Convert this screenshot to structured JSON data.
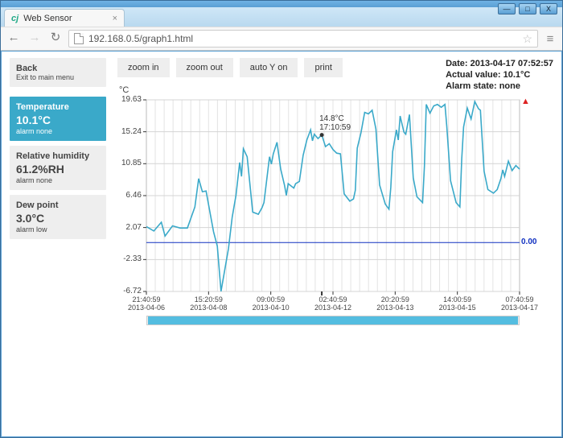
{
  "browser": {
    "tab_title": "Web Sensor",
    "url": "192.168.0.5/graph1.html",
    "wc_min": "—",
    "wc_max": "□",
    "wc_close": "X",
    "tab_close": "×",
    "star": "☆",
    "menu": "≡",
    "nav_back": "←",
    "nav_fwd": "→",
    "nav_reload": "↻"
  },
  "sidebar": {
    "back": {
      "title": "Back",
      "sub": "Exit to main menu"
    },
    "cards": [
      {
        "title": "Temperature",
        "value": "10.1°C",
        "alarm": "alarm none",
        "active": true
      },
      {
        "title": "Relative humidity",
        "value": "61.2%RH",
        "alarm": "alarm none",
        "active": false
      },
      {
        "title": "Dew point",
        "value": "3.0°C",
        "alarm": "alarm low",
        "active": false
      }
    ]
  },
  "toolbar": {
    "zoom_in": "zoom in",
    "zoom_out": "zoom out",
    "auto_y": "auto Y on",
    "print": "print"
  },
  "info": {
    "date": "Date: 2013-04-17 07:52:57",
    "actual": "Actual value: 10.1°C",
    "alarm": "Alarm state: none"
  },
  "chart_data": {
    "type": "line",
    "unit": "°C",
    "ylim": [
      -6.72,
      19.63
    ],
    "yticks": [
      19.63,
      15.24,
      10.85,
      6.46,
      2.07,
      -2.33,
      -6.72
    ],
    "zero_line": 0.0,
    "zero_label": "0.00",
    "xticks": [
      {
        "time": "21:40:59",
        "date": "2013-04-06"
      },
      {
        "time": "15:20:59",
        "date": "2013-04-08"
      },
      {
        "time": "09:00:59",
        "date": "2013-04-10"
      },
      {
        "time": "02:40:59",
        "date": "2013-04-12"
      },
      {
        "time": "20:20:59",
        "date": "2013-04-13"
      },
      {
        "time": "14:00:59",
        "date": "2013-04-15"
      },
      {
        "time": "07:40:59",
        "date": "2013-04-17"
      }
    ],
    "marker": {
      "value": "14.8°C",
      "time": "17:10:59",
      "x_frac": 0.47,
      "y_val": 14.8
    },
    "series": [
      {
        "name": "Temperature",
        "points": [
          [
            0.0,
            2.2
          ],
          [
            0.02,
            1.6
          ],
          [
            0.04,
            2.8
          ],
          [
            0.05,
            0.9
          ],
          [
            0.07,
            2.3
          ],
          [
            0.09,
            2.0
          ],
          [
            0.11,
            2.0
          ],
          [
            0.13,
            4.9
          ],
          [
            0.14,
            8.8
          ],
          [
            0.15,
            7.0
          ],
          [
            0.16,
            7.1
          ],
          [
            0.18,
            1.5
          ],
          [
            0.19,
            -0.5
          ],
          [
            0.2,
            -6.7
          ],
          [
            0.22,
            -0.8
          ],
          [
            0.23,
            3.5
          ],
          [
            0.24,
            6.5
          ],
          [
            0.25,
            11.0
          ],
          [
            0.255,
            9.1
          ],
          [
            0.26,
            12.9
          ],
          [
            0.27,
            11.8
          ],
          [
            0.285,
            4.2
          ],
          [
            0.3,
            3.9
          ],
          [
            0.31,
            4.8
          ],
          [
            0.315,
            5.5
          ],
          [
            0.33,
            11.8
          ],
          [
            0.335,
            10.8
          ],
          [
            0.34,
            12.2
          ],
          [
            0.35,
            13.8
          ],
          [
            0.36,
            10.1
          ],
          [
            0.37,
            7.9
          ],
          [
            0.375,
            6.5
          ],
          [
            0.38,
            8.1
          ],
          [
            0.395,
            7.5
          ],
          [
            0.4,
            8.1
          ],
          [
            0.41,
            8.4
          ],
          [
            0.42,
            12.0
          ],
          [
            0.43,
            14.1
          ],
          [
            0.44,
            15.5
          ],
          [
            0.445,
            14.0
          ],
          [
            0.45,
            14.9
          ],
          [
            0.46,
            14.3
          ],
          [
            0.47,
            14.8
          ],
          [
            0.48,
            13.2
          ],
          [
            0.49,
            13.6
          ],
          [
            0.5,
            12.8
          ],
          [
            0.51,
            12.3
          ],
          [
            0.52,
            12.2
          ],
          [
            0.53,
            6.7
          ],
          [
            0.545,
            5.7
          ],
          [
            0.555,
            6.0
          ],
          [
            0.56,
            7.2
          ],
          [
            0.565,
            13.0
          ],
          [
            0.575,
            15.1
          ],
          [
            0.585,
            17.9
          ],
          [
            0.595,
            17.7
          ],
          [
            0.605,
            18.2
          ],
          [
            0.615,
            15.6
          ],
          [
            0.625,
            7.9
          ],
          [
            0.64,
            5.3
          ],
          [
            0.65,
            4.6
          ],
          [
            0.655,
            7.6
          ],
          [
            0.66,
            12.5
          ],
          [
            0.67,
            15.5
          ],
          [
            0.675,
            14.1
          ],
          [
            0.68,
            17.4
          ],
          [
            0.69,
            15.2
          ],
          [
            0.695,
            14.9
          ],
          [
            0.705,
            17.6
          ],
          [
            0.715,
            8.9
          ],
          [
            0.725,
            6.3
          ],
          [
            0.74,
            5.5
          ],
          [
            0.745,
            10.5
          ],
          [
            0.75,
            19.0
          ],
          [
            0.76,
            17.8
          ],
          [
            0.77,
            18.8
          ],
          [
            0.78,
            19.0
          ],
          [
            0.79,
            18.6
          ],
          [
            0.8,
            19.0
          ],
          [
            0.805,
            16.0
          ],
          [
            0.815,
            8.5
          ],
          [
            0.83,
            5.5
          ],
          [
            0.84,
            4.9
          ],
          [
            0.845,
            11.5
          ],
          [
            0.85,
            15.9
          ],
          [
            0.855,
            17.2
          ],
          [
            0.86,
            18.5
          ],
          [
            0.87,
            17.0
          ],
          [
            0.88,
            19.4
          ],
          [
            0.89,
            18.4
          ],
          [
            0.895,
            18.2
          ],
          [
            0.905,
            9.8
          ],
          [
            0.915,
            7.3
          ],
          [
            0.93,
            6.8
          ],
          [
            0.94,
            7.3
          ],
          [
            0.95,
            8.8
          ],
          [
            0.955,
            10.0
          ],
          [
            0.96,
            9.1
          ],
          [
            0.97,
            11.2
          ],
          [
            0.98,
            9.9
          ],
          [
            0.99,
            10.6
          ],
          [
            1.0,
            10.1
          ]
        ]
      }
    ]
  }
}
